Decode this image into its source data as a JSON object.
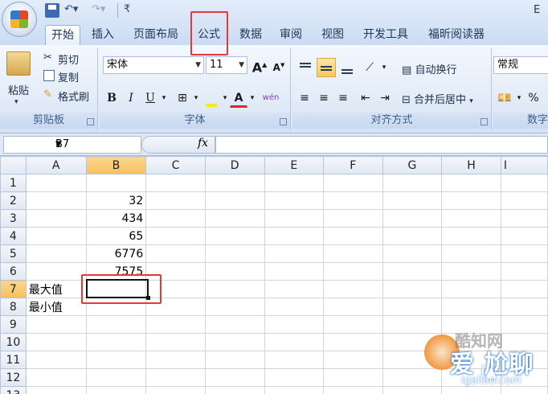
{
  "quick_access": {
    "save": "save",
    "undo": "↶▾",
    "redo": "↷▾",
    "more": "₹"
  },
  "title_right": "E",
  "tabs": [
    "开始",
    "插入",
    "页面布局",
    "公式",
    "数据",
    "审阅",
    "视图",
    "开发工具",
    "福昕阅读器"
  ],
  "ribbon": {
    "clipboard": {
      "paste": "粘贴",
      "cut": "剪切",
      "copy": "复制",
      "format_painter": "格式刷",
      "label": "剪贴板"
    },
    "font": {
      "name": "宋体",
      "size": "11",
      "grow": "A",
      "shrink": "A",
      "bold": "B",
      "italic": "I",
      "underline": "U",
      "wen": "wén",
      "label": "字体"
    },
    "alignment": {
      "wrap": "自动换行",
      "merge": "合并后居中",
      "label": "对齐方式"
    },
    "number": {
      "format": "常规",
      "percent": "%",
      "label": "数字"
    }
  },
  "formula_bar": {
    "name_box": "B7",
    "fx": "fx",
    "value": ""
  },
  "columns": [
    "A",
    "B",
    "C",
    "D",
    "E",
    "F",
    "G",
    "H",
    "I"
  ],
  "rows": [
    {
      "n": "1",
      "a": "",
      "b": ""
    },
    {
      "n": "2",
      "a": "",
      "b": "32"
    },
    {
      "n": "3",
      "a": "",
      "b": "434"
    },
    {
      "n": "4",
      "a": "",
      "b": "65"
    },
    {
      "n": "5",
      "a": "",
      "b": "6776"
    },
    {
      "n": "6",
      "a": "",
      "b": "7575"
    },
    {
      "n": "7",
      "a": "最大值",
      "b": ""
    },
    {
      "n": "8",
      "a": "最小值",
      "b": ""
    },
    {
      "n": "9",
      "a": "",
      "b": ""
    },
    {
      "n": "10",
      "a": "",
      "b": ""
    },
    {
      "n": "11",
      "a": "",
      "b": ""
    },
    {
      "n": "12",
      "a": "",
      "b": ""
    },
    {
      "n": "13",
      "a": "",
      "b": ""
    }
  ],
  "watermark": {
    "title": "酷知网",
    "main": "爱 尬聊",
    "main2": "i▲",
    "url": "igaliao.com"
  },
  "colors": {
    "highlight": "#e03a3a",
    "ribbon": "#dfe9f5",
    "selected_header": "#f6c05c"
  }
}
